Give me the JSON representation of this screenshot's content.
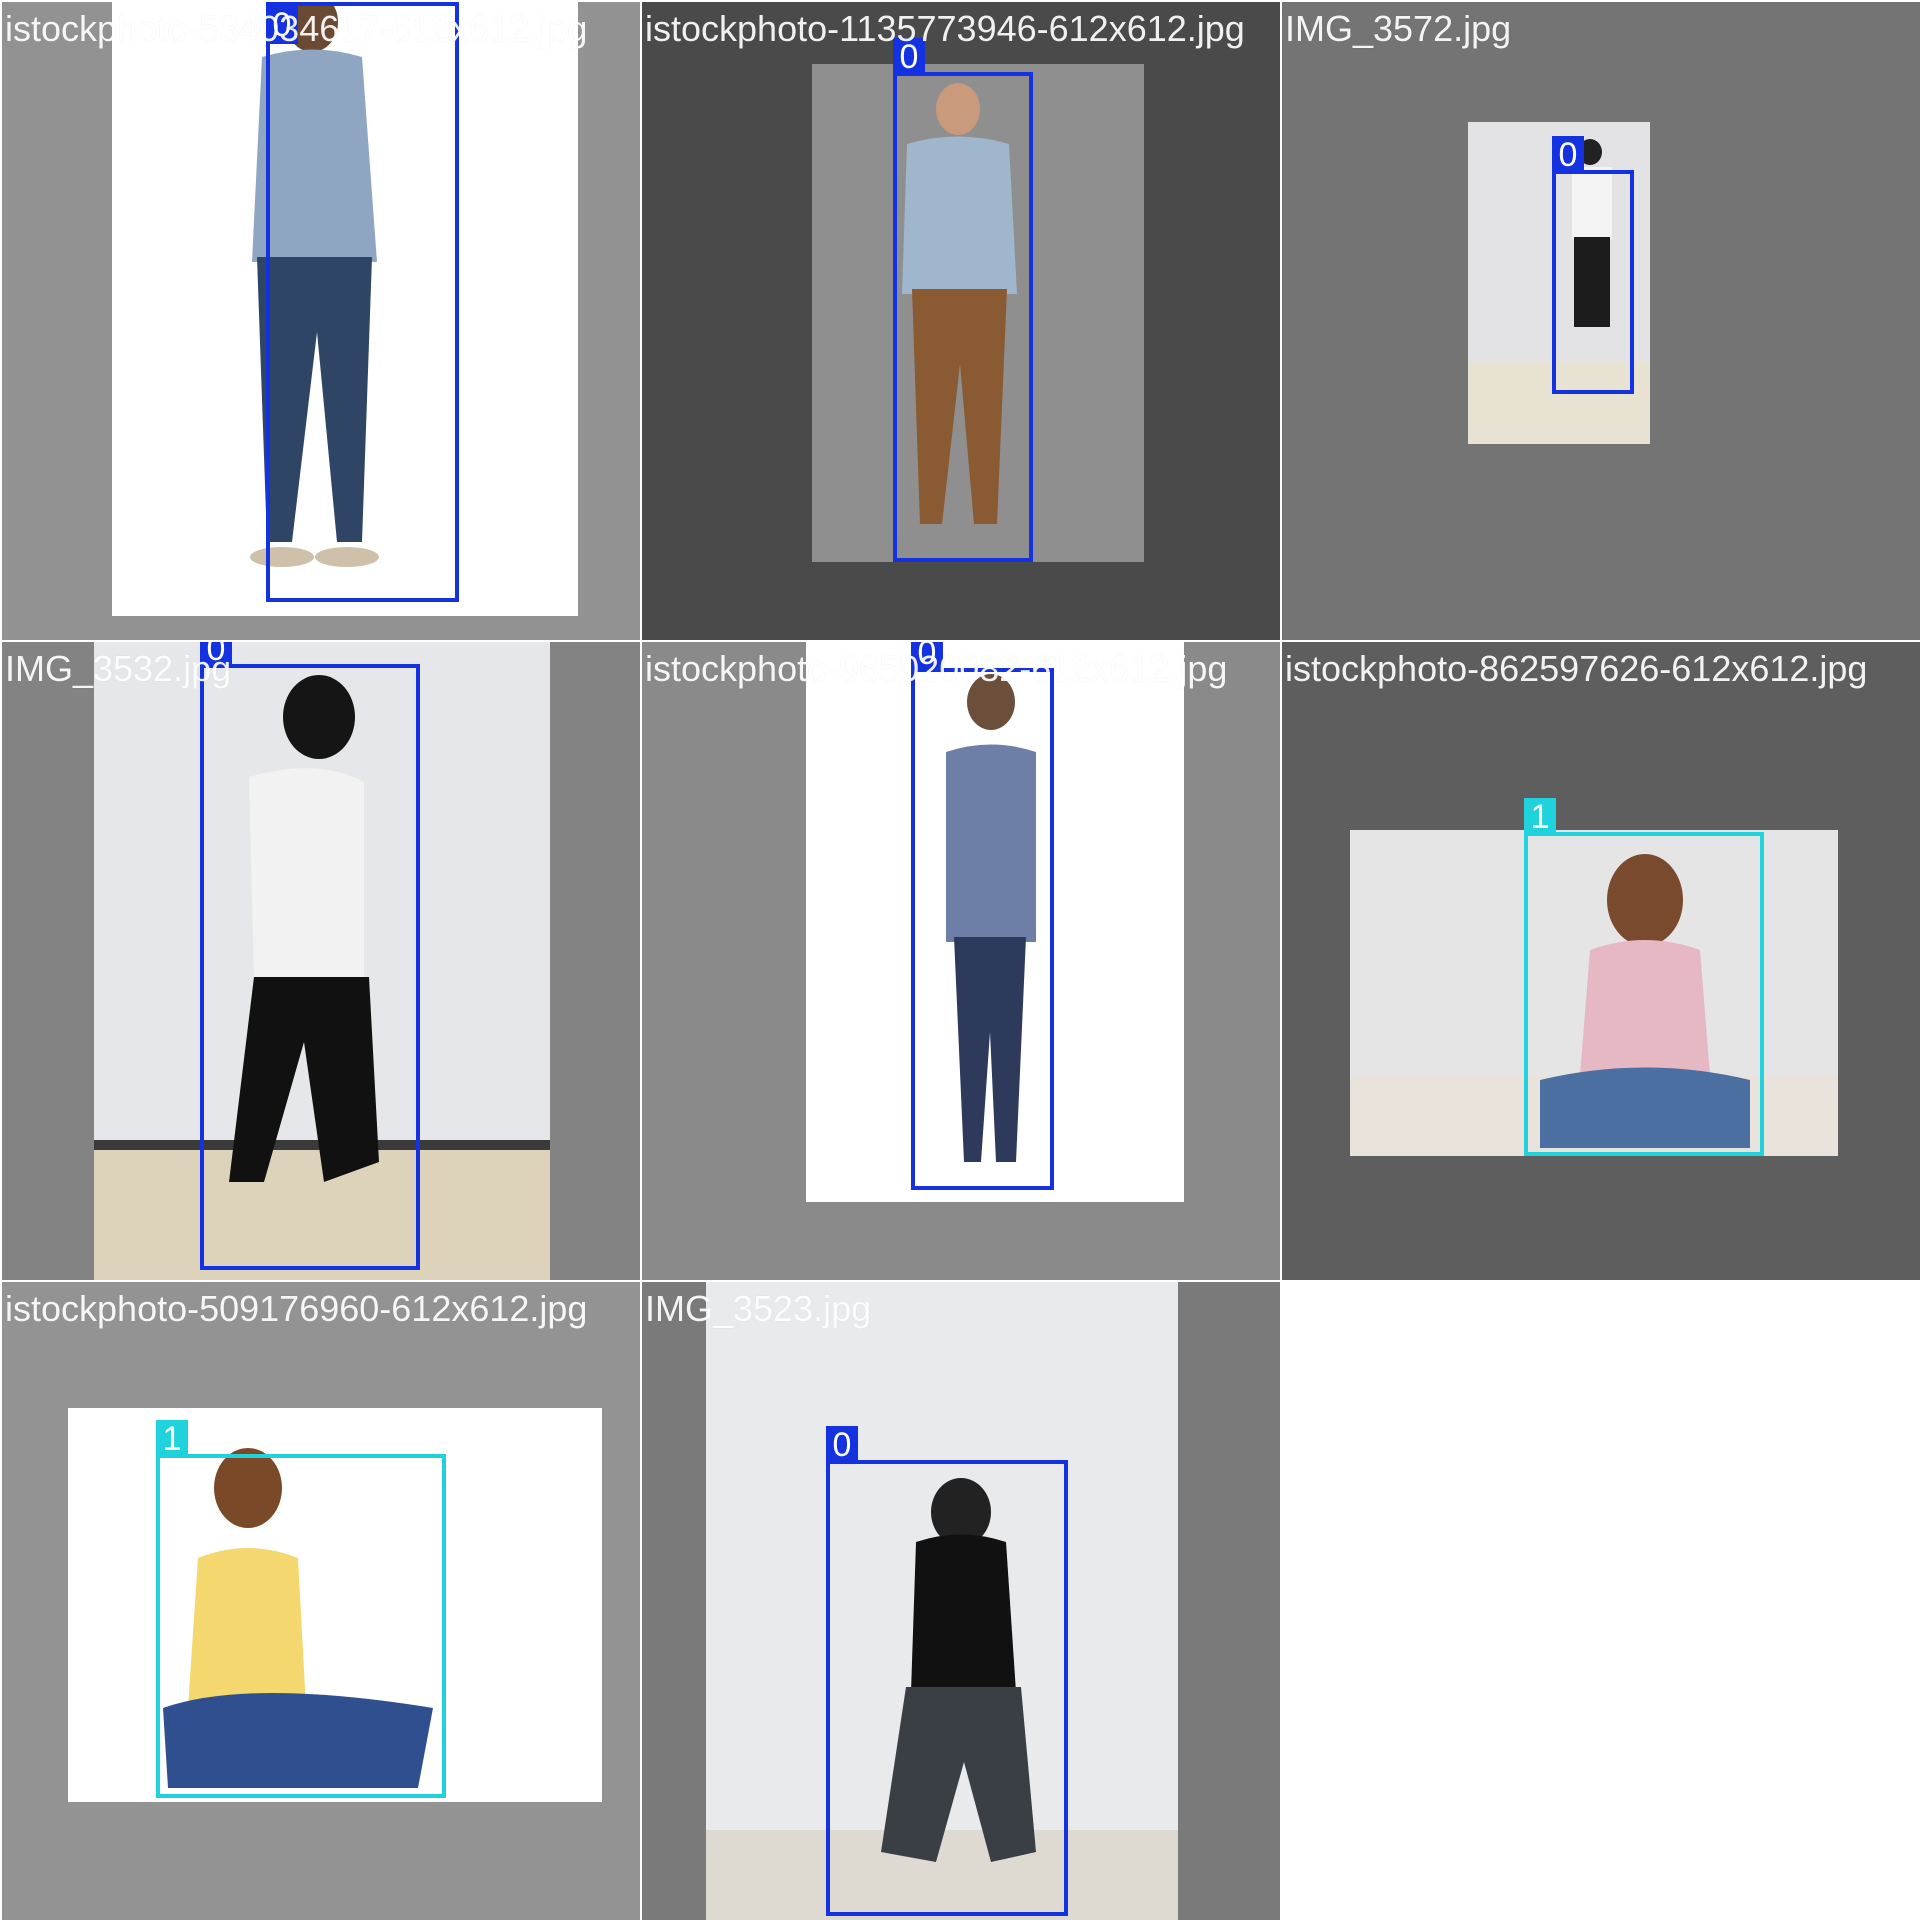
{
  "grid": {
    "tiles": [
      {
        "filename": "istockphoto-534034617-612x612.jpg",
        "boxes": [
          {
            "class_label": "0"
          }
        ]
      },
      {
        "filename": "istockphoto-1135773946-612x612.jpg",
        "boxes": [
          {
            "class_label": "0"
          }
        ]
      },
      {
        "filename": "IMG_3572.jpg",
        "boxes": [
          {
            "class_label": "0"
          }
        ]
      },
      {
        "filename": "IMG_3532.jpg",
        "boxes": [
          {
            "class_label": "0"
          }
        ]
      },
      {
        "filename": "istockphoto-965020082-612x612.jpg",
        "boxes": [
          {
            "class_label": "0"
          }
        ]
      },
      {
        "filename": "istockphoto-862597626-612x612.jpg",
        "boxes": [
          {
            "class_label": "1"
          }
        ]
      },
      {
        "filename": "istockphoto-509176960-612x612.jpg",
        "boxes": [
          {
            "class_label": "1"
          }
        ]
      },
      {
        "filename": "IMG_3523.jpg",
        "boxes": [
          {
            "class_label": "0"
          }
        ]
      }
    ]
  },
  "colors": {
    "class_0_box": "#1432e0",
    "class_1_box": "#20d2dc",
    "label_text": "#ffffff"
  }
}
